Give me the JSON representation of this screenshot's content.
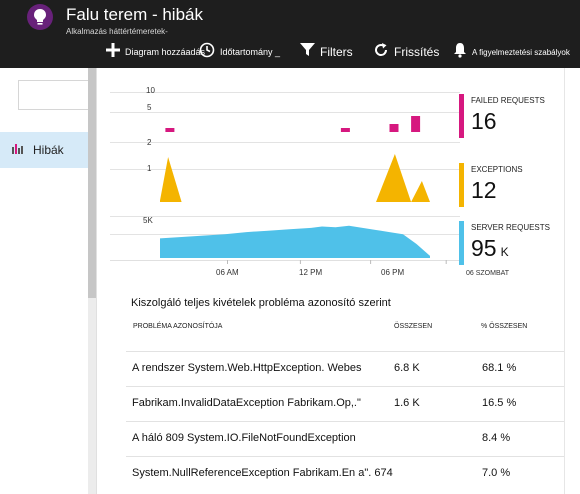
{
  "header": {
    "title": "Falu terem - hibák",
    "subtitle": "Alkalmazás háttértémeretek-",
    "toolbar": [
      {
        "label": "Diagram hozzáadás",
        "icon": "plus-icon"
      },
      {
        "label": "Időtartomány _",
        "icon": "clock-icon"
      },
      {
        "label": "Filters",
        "icon": "filter-icon"
      },
      {
        "label": "Frissítés",
        "icon": "refresh-icon"
      },
      {
        "label": "A figyelmeztetési szabályok",
        "icon": "bell-icon"
      }
    ]
  },
  "sidebar": {
    "items": [
      {
        "label": "Hibák",
        "icon": "bar-chart-icon",
        "selected": true
      }
    ]
  },
  "metrics": [
    {
      "title": "FAILED REQUESTS",
      "value": "16",
      "unit": "",
      "color": "#d6187f"
    },
    {
      "title": "EXCEPTIONS",
      "value": "12",
      "unit": "",
      "color": "#f4b400"
    },
    {
      "title": "SERVER REQUESTS",
      "value": "95",
      "unit": "K",
      "color": "#4fc1e9"
    }
  ],
  "chart_data": [
    {
      "type": "bar",
      "title": "Failed requests",
      "ylabels": [
        "10",
        "5"
      ],
      "ylim": [
        0,
        10
      ],
      "points": [
        {
          "x": 0.02,
          "y": 1
        },
        {
          "x": 0.67,
          "y": 1
        },
        {
          "x": 0.85,
          "y": 2
        },
        {
          "x": 0.93,
          "y": 4
        }
      ]
    },
    {
      "type": "area",
      "title": "Exceptions",
      "ylabels": [
        "2",
        "1"
      ],
      "ylim": [
        0,
        2
      ],
      "points": [
        [
          0,
          0.05
        ],
        [
          0.03,
          1.5
        ],
        [
          0.08,
          0
        ],
        [
          0.8,
          0
        ],
        [
          0.87,
          1.6
        ],
        [
          0.93,
          0
        ],
        [
          0.97,
          0.7
        ],
        [
          1,
          0
        ]
      ]
    },
    {
      "type": "area",
      "title": "Server requests",
      "ylabels": [
        "5K"
      ],
      "ylim": [
        0,
        6000
      ],
      "points": [
        [
          0,
          2800
        ],
        [
          0.08,
          3000
        ],
        [
          0.16,
          3200
        ],
        [
          0.24,
          3400
        ],
        [
          0.32,
          3700
        ],
        [
          0.4,
          3900
        ],
        [
          0.48,
          4100
        ],
        [
          0.56,
          4300
        ],
        [
          0.6,
          4500
        ],
        [
          0.65,
          4400
        ],
        [
          0.7,
          4600
        ],
        [
          0.75,
          4300
        ],
        [
          0.8,
          4000
        ],
        [
          0.85,
          3700
        ],
        [
          0.9,
          3400
        ],
        [
          0.95,
          2000
        ],
        [
          1,
          300
        ]
      ]
    }
  ],
  "xaxis": {
    "ticks": [
      {
        "label": "06 AM",
        "pos": 0.25
      },
      {
        "label": "12 PM",
        "pos": 0.52
      },
      {
        "label": "06 PM",
        "pos": 0.78
      },
      {
        "label": "06 SZOMBAT",
        "pos": 1.06
      }
    ]
  },
  "table": {
    "title": "Kiszolgáló teljes kivételek probléma azonosító szerint",
    "columns": [
      "PROBLÉMA AZONOSÍTÓJA",
      "ÖSSZESEN",
      "% ÖSSZESEN"
    ],
    "rows": [
      [
        "A rendszer System.Web.HttpException. Webes",
        "6.8 K",
        "68.1 %"
      ],
      [
        "Fabrikam.InvalidDataException Fabrikam.Op,.\"",
        "1.6 K",
        "16.5 %"
      ],
      [
        "A háló 809 System.IO.FileNotFoundException",
        "",
        "8.4 %"
      ],
      [
        "System.NullReferenceException Fabrikam.En a\". 674",
        "",
        "7.0 %"
      ]
    ]
  }
}
